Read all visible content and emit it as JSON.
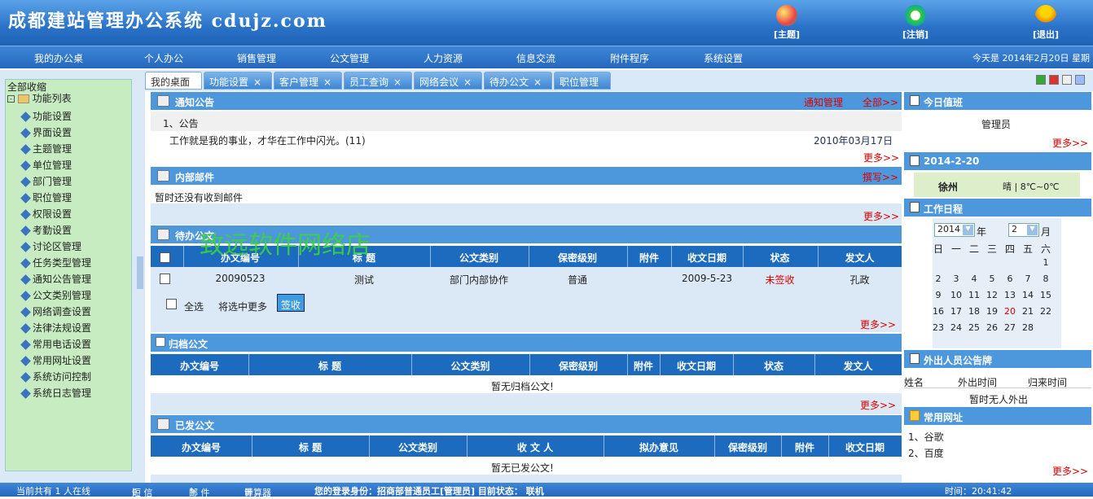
{
  "header": {
    "title": "成都建站管理办公系统 cdujz.com",
    "buttons": [
      {
        "label": "[主题]",
        "icon": "globe-icon"
      },
      {
        "label": "[注销]",
        "icon": "refresh-icon"
      },
      {
        "label": "[退出]",
        "icon": "exit-person-icon"
      }
    ]
  },
  "menu": {
    "items": [
      "我的办公桌",
      "个人办公",
      "销售管理",
      "公文管理",
      "人力资源",
      "信息交流",
      "附件程序",
      "系统设置"
    ],
    "date": "今天是 2014年2月20日 星期"
  },
  "tabs": [
    {
      "label": "我的桌面",
      "closable": false
    },
    {
      "label": "功能设置",
      "closable": true
    },
    {
      "label": "客户管理",
      "closable": true
    },
    {
      "label": "员工查询",
      "closable": true
    },
    {
      "label": "网络会议",
      "closable": true
    },
    {
      "label": "待办公文",
      "closable": true
    },
    {
      "label": "职位管理",
      "closable": false
    }
  ],
  "tab_close": "×",
  "sidebar": {
    "collapse_all": "全部收缩",
    "root": "功能列表",
    "items": [
      "功能设置",
      "界面设置",
      "主题管理",
      "单位管理",
      "部门管理",
      "职位管理",
      "权限设置",
      "考勤设置",
      "讨论区管理",
      "任务类型管理",
      "通知公告管理",
      "公文类别管理",
      "网络调查设置",
      "法律法规设置",
      "常用电话设置",
      "常用网址设置",
      "系统访问控制",
      "系统日志管理"
    ]
  },
  "notice": {
    "title": "通知公告",
    "manage": "通知管理",
    "all": "全部>>",
    "category": "1、公告",
    "item": "工作就是我的事业，才华在工作中闪光。(11)",
    "date": "2010年03月17日",
    "more": "更多>>"
  },
  "mail": {
    "title": "内部邮件",
    "compose": "撰写>>",
    "empty": "暂时还没有收到邮件",
    "more": "更多>>"
  },
  "pending": {
    "title": "待办公文",
    "headers": [
      "办文编号",
      "标 题",
      "公文类别",
      "保密级别",
      "附件",
      "收文日期",
      "状态",
      "发文人"
    ],
    "rows": [
      {
        "no": "20090523",
        "title": "测试",
        "category": "部门内部协作",
        "secret": "普通",
        "attach": "",
        "date": "2009-5-23",
        "status": "未签收",
        "sender": "孔政"
      }
    ],
    "select_all": "全选",
    "batch": "将选中更多",
    "sign_button": "签收",
    "more": "更多>>"
  },
  "archive": {
    "title": "归档公文",
    "headers": [
      "办文编号",
      "标 题",
      "公文类别",
      "保密级别",
      "附件",
      "收文日期",
      "状态",
      "发文人"
    ],
    "empty": "暂无归档公文!",
    "more": "更多>>"
  },
  "sent": {
    "title": "已发公文",
    "headers": [
      "办文编号",
      "标 题",
      "公文类别",
      "收 文 人",
      "拟办意见",
      "保密级别",
      "附件",
      "收文日期"
    ],
    "empty": "暂无已发公文!",
    "more": "更多>>"
  },
  "duty": {
    "title": "今日值班",
    "person": "管理员",
    "more": "更多>>"
  },
  "weather": {
    "title": "2014-2-20",
    "city": "徐州",
    "desc": "晴 | 8℃~0℃"
  },
  "calendar": {
    "title": "工作日程",
    "year": "2014",
    "year_label": "年",
    "month": "2",
    "month_label": "月",
    "weekdays": [
      "日",
      "一",
      "二",
      "三",
      "四",
      "五",
      "六"
    ],
    "days": [
      [
        "",
        "",
        "",
        "",
        "",
        "",
        "1"
      ],
      [
        "2",
        "3",
        "4",
        "5",
        "6",
        "7",
        "8"
      ],
      [
        "9",
        "10",
        "11",
        "12",
        "13",
        "14",
        "15"
      ],
      [
        "16",
        "17",
        "18",
        "19",
        "20",
        "21",
        "22"
      ],
      [
        "23",
        "24",
        "25",
        "26",
        "27",
        "28",
        ""
      ]
    ],
    "today": "20"
  },
  "outing": {
    "title": "外出人员公告牌",
    "headers": [
      "姓名",
      "外出时间",
      "归来时间"
    ],
    "empty": "暂时无人外出"
  },
  "links": {
    "title": "常用网址",
    "items": [
      "1、谷歌",
      "2、百度"
    ],
    "more": "更多>>"
  },
  "watermark": "致远软件网络店",
  "footer": {
    "online": "当前共有 1 人在线",
    "sms": "短 信",
    "mail": "邮 件",
    "calc": "计算器",
    "login": "您的登录身份：招商部普通员工[管理员]  目前状态：  联机",
    "time": "时间：20:41:42"
  }
}
